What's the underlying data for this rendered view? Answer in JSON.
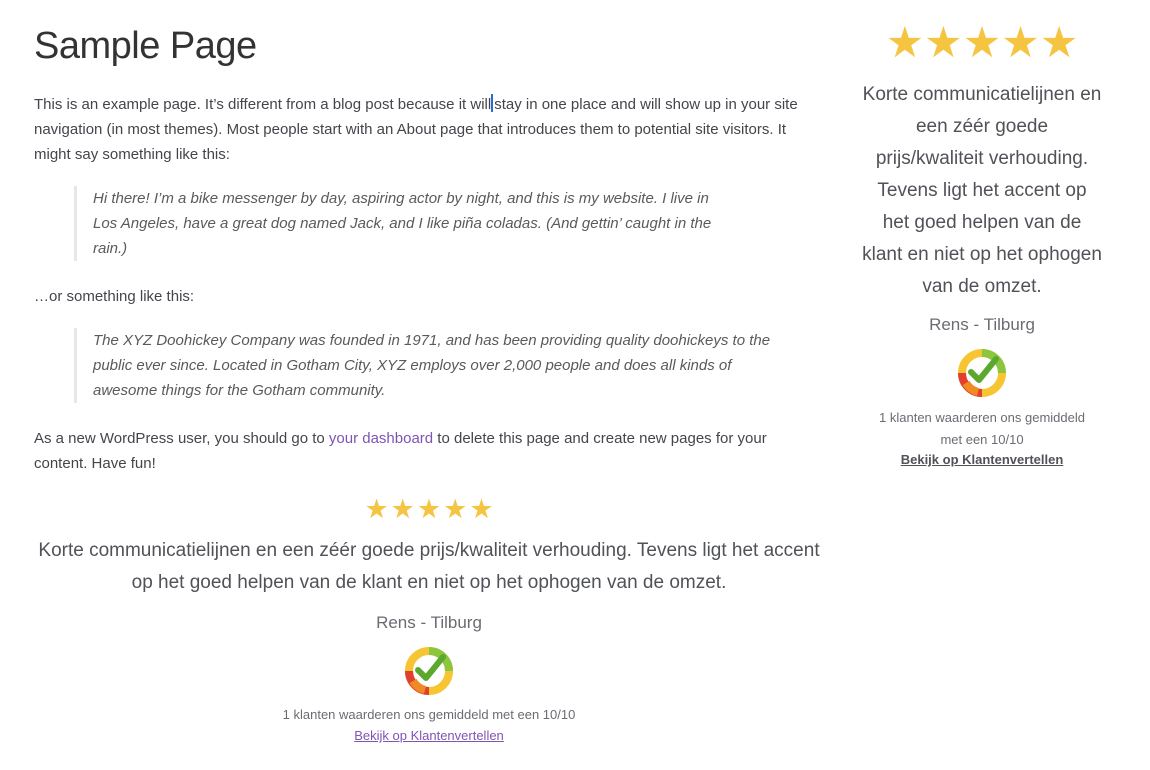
{
  "page": {
    "title": "Sample Page",
    "intro_before_caret": "This is an example page. It’s different from a blog post because it will",
    "intro_after_caret": "stay in one place and will show up in your site navigation (in most themes). Most people start with an About page that introduces them to potential site visitors. It might say something like this:",
    "quote1": "Hi there! I’m a bike messenger by day, aspiring actor by night, and this is my website. I live in Los Angeles, have a great dog named Jack, and I like piña coladas. (And gettin’ caught in the rain.)",
    "separator": "…or something like this:",
    "quote2": "The XYZ Doohickey Company was founded in 1971, and has been providing quality doohickeys to the public ever since. Located in Gotham City, XYZ employs over 2,000 people and does all kinds of awesome things for the Gotham community.",
    "outro_before_link": "As a new WordPress user, you should go to ",
    "outro_link": "your dashboard",
    "outro_after_link": " to delete this page and create new pages for your content. Have fun!"
  },
  "review_main": {
    "rating": 5,
    "star_glyph": "★",
    "text": "Korte communicatielijnen en een zéér goede prijs/kwaliteit verhouding. Tevens ligt het accent op het goed helpen van de klant en niet op het ophogen van de omzet.",
    "reviewer": "Rens - Tilburg",
    "badge_icon": "klantenvertellen-check-badge",
    "stat": "1 klanten waarderen ons gemiddeld met een 10/10",
    "link": "Bekijk op Klantenvertellen"
  },
  "sidebar_review": {
    "rating": 5,
    "star_glyph": "★",
    "text": "Korte communicatielijnen en een zéér goede prijs/kwaliteit verhouding. Tevens ligt het accent op het goed helpen van de klant en niet op het ophogen van de omzet.",
    "reviewer": "Rens - Tilburg",
    "badge_icon": "klantenvertellen-check-badge",
    "stat_line1": "1 klanten waarderen ons gemiddeld",
    "stat_line2": "met een 10/10",
    "link": "Bekijk op Klantenvertellen"
  },
  "colors": {
    "star": "#f5c542",
    "link": "#7f54b3",
    "badge_green": "#8cc63f",
    "badge_yellow": "#f6c531",
    "badge_orange": "#f08a24",
    "badge_red": "#e2402f"
  }
}
